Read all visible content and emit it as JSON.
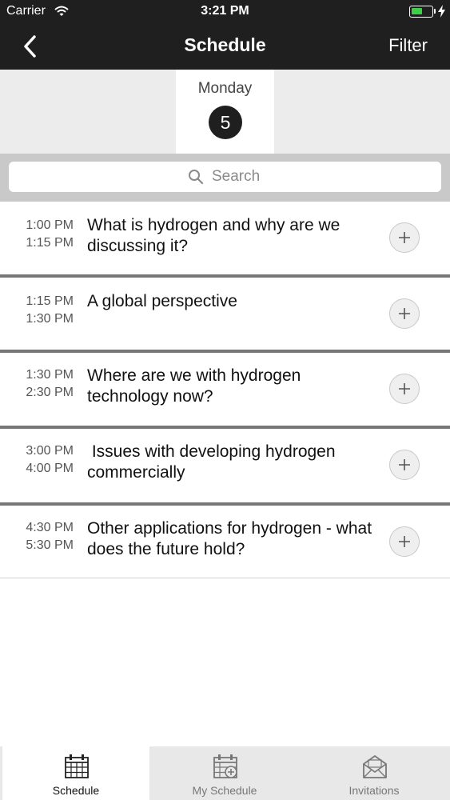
{
  "status_bar": {
    "carrier": "Carrier",
    "time": "3:21 PM",
    "battery_level": 0.55,
    "battery_color": "#3ecf4a"
  },
  "nav": {
    "back_icon": "chevron-left-icon",
    "title": "Schedule",
    "filter_label": "Filter"
  },
  "day": {
    "name": "Monday",
    "number": "5"
  },
  "search": {
    "placeholder": "Search",
    "icon": "search-icon"
  },
  "sessions": [
    {
      "start": "1:00 PM",
      "end": "1:15 PM",
      "title": "What is hydrogen and why are we discussing it?"
    },
    {
      "start": "1:15 PM",
      "end": "1:30 PM",
      "title": "A global perspective"
    },
    {
      "start": "1:30 PM",
      "end": "2:30 PM",
      "title": "Where are we with hydrogen technology now?"
    },
    {
      "start": "3:00 PM",
      "end": "4:00 PM",
      "title": " Issues with developing hydrogen commercially"
    },
    {
      "start": "4:30 PM",
      "end": "5:30 PM",
      "title": "Other applications for hydrogen - what does the future hold?"
    }
  ],
  "tabs": [
    {
      "label": "Schedule",
      "icon": "calendar-icon",
      "active": true
    },
    {
      "label": "My Schedule",
      "icon": "calendar-add-icon",
      "active": false
    },
    {
      "label": "Invitations",
      "icon": "envelope-icon",
      "active": false
    }
  ],
  "colors": {
    "bar_dark": "#1f1f1f",
    "divider": "#777777"
  }
}
